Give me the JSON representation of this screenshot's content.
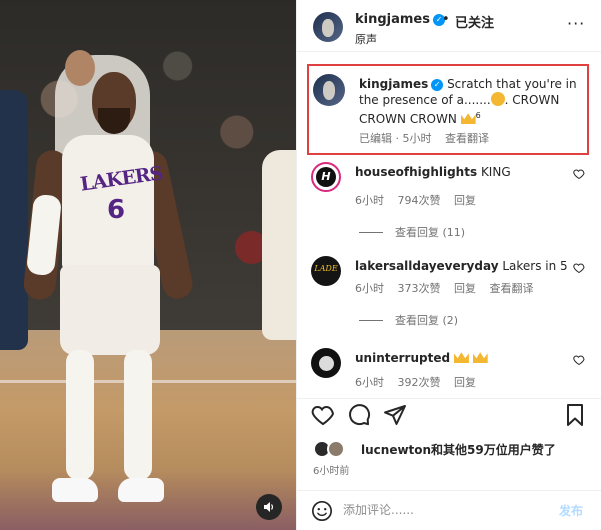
{
  "header": {
    "username": "kingjames",
    "dot": "•",
    "follow_label": "已关注",
    "audio_label": "原声",
    "more": "···"
  },
  "caption": {
    "username": "kingjames",
    "text_part1": "Scratch that you're in the presence of a.......",
    "text_part2": ". CROWN CROWN CROWN",
    "superscript": "6",
    "edited": "已编辑",
    "time": "· 5小时",
    "translate": "查看翻译"
  },
  "comments": [
    {
      "username": "houseofhighlights",
      "text": "KING",
      "time": "6小时",
      "likes": "794次赞",
      "reply": "回复",
      "view_replies": "查看回复 (11)"
    },
    {
      "username": "lakersalldayeveryday",
      "text": "Lakers in 5",
      "time": "6小时",
      "likes": "373次赞",
      "reply": "回复",
      "translate": "查看翻译",
      "view_replies": "查看回复 (2)",
      "avatar_text": "LADE"
    },
    {
      "username": "uninterrupted",
      "text": "",
      "time": "6小时",
      "likes": "392次赞",
      "reply": "回复"
    }
  ],
  "likes_summary": "lucnewton和其他59万位用户赞了",
  "posted_time": "6小时前",
  "composer": {
    "placeholder": "添加评论......",
    "post_label": "发布"
  },
  "photo": {
    "jersey_team": "LAKERS",
    "jersey_number": "6"
  },
  "colors": {
    "verified": "#0095f6",
    "highlight_border": "#e0403f",
    "lakers_purple": "#552583"
  }
}
